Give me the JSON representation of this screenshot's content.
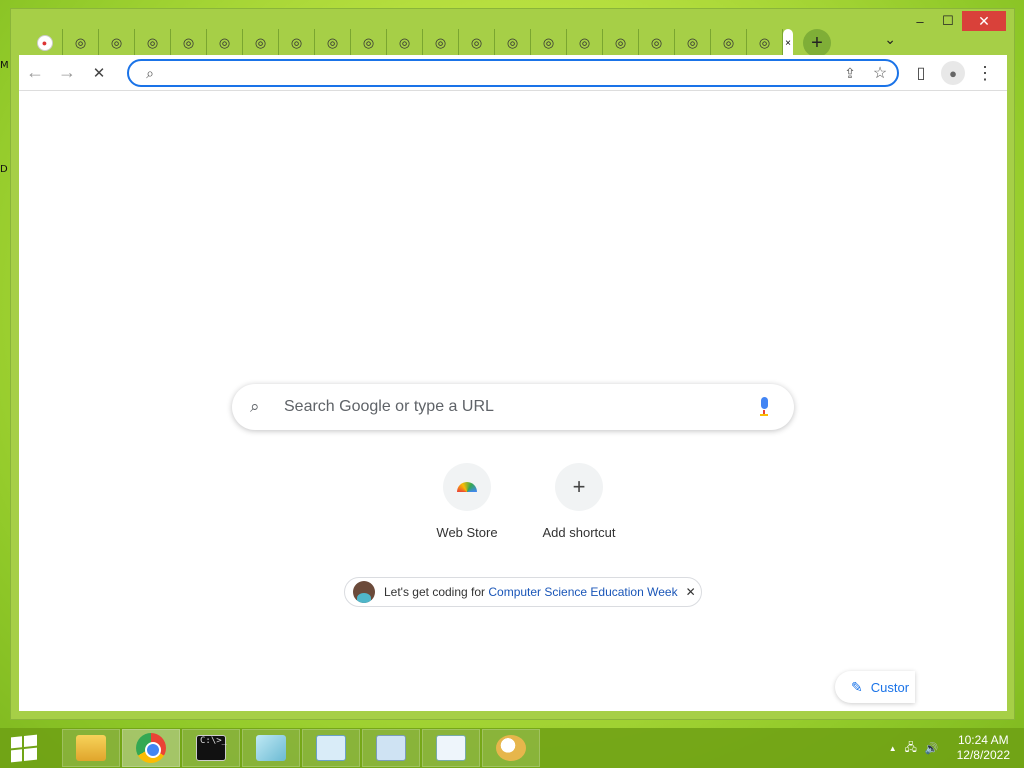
{
  "desktop": {
    "side_labels": [
      "M",
      "D"
    ]
  },
  "window": {
    "min": "–",
    "max": "☐",
    "close": "✕"
  },
  "tabs": {
    "first_favicon": "●",
    "chrome_favicon": "◎",
    "active_close": "×",
    "new_tab": "+",
    "dropdown": "⌄",
    "count": 21
  },
  "toolbar": {
    "back": "←",
    "forward": "→",
    "stop": "✕",
    "search_icon": "⌕",
    "address_value": "",
    "share": "⇪",
    "bookmark": "☆",
    "side_panel": "▯",
    "profile": "●",
    "menu": "⋮"
  },
  "ntp": {
    "search_placeholder": "Search Google or type a URL",
    "shortcuts": [
      {
        "label": "Web Store",
        "icon": "webstore-icon"
      },
      {
        "label": "Add shortcut",
        "icon": "plus-icon",
        "glyph": "+"
      }
    ],
    "promo": {
      "text": "Let's get coding for ",
      "link": "Computer Science Education Week",
      "close": "✕"
    },
    "customize_label": "Custor"
  },
  "taskbar": {
    "apps": [
      "file-explorer",
      "chrome",
      "command-prompt",
      "notepad",
      "control-panel",
      "calculator",
      "wordpad",
      "paint"
    ],
    "cmd_text": "C:\\>_",
    "tray_arrow": "▲",
    "network": "🖧",
    "volume": "🔊",
    "time": "10:24 AM",
    "date": "12/8/2022"
  }
}
